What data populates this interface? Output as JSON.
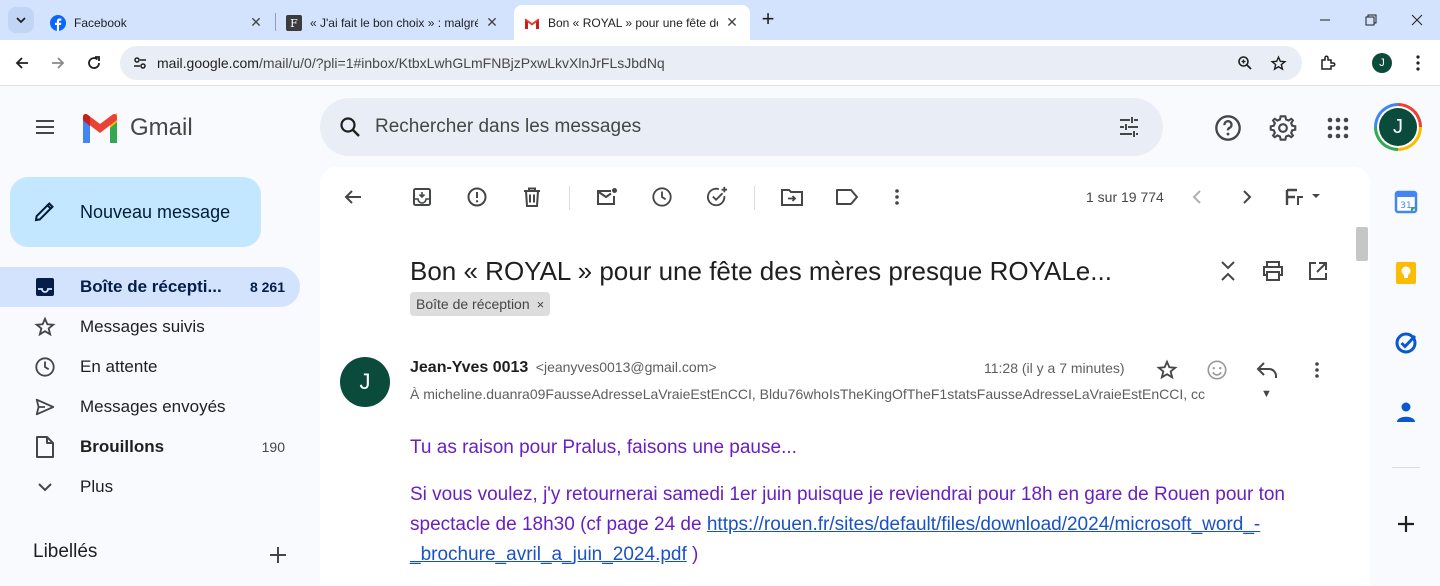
{
  "browser": {
    "tabs": [
      {
        "title": "Facebook",
        "icon": "facebook-icon",
        "active": false
      },
      {
        "title": "« J'ai fait le bon choix » : malgré",
        "icon": "newspaper-icon",
        "active": false
      },
      {
        "title": "Bon « ROYAL » pour une fête des",
        "icon": "gmail-icon",
        "active": true
      }
    ],
    "new_tab": "+",
    "url_host": "mail.google.com",
    "url_path": "/mail/u/0/?pli=1#inbox/KtbxLwhGLmFNBjzPxwLkvXlnJrFLsJbdNq",
    "profile_initial": "J"
  },
  "gmail": {
    "product_name": "Gmail",
    "search_placeholder": "Rechercher dans les messages",
    "account_initial": "J",
    "compose_label": "Nouveau message",
    "nav": [
      {
        "label": "Boîte de récepti...",
        "count": "8 261",
        "icon": "inbox-icon",
        "active": true
      },
      {
        "label": "Messages suivis",
        "count": "",
        "icon": "star-icon",
        "active": false
      },
      {
        "label": "En attente",
        "count": "",
        "icon": "clock-icon",
        "active": false
      },
      {
        "label": "Messages envoyés",
        "count": "",
        "icon": "send-icon",
        "active": false
      },
      {
        "label": "Brouillons",
        "count": "190",
        "icon": "draft-icon",
        "active": false
      },
      {
        "label": "Plus",
        "count": "",
        "icon": "chevron-down-icon",
        "active": false
      }
    ],
    "labels_header": "Libellés",
    "pager": "1 sur 19 774",
    "subject": "Bon « ROYAL » pour une fête des mères presque ROYALe...",
    "label_chip": "Boîte de réception",
    "label_chip_close": "×",
    "message": {
      "sender_initial": "J",
      "sender_name": "Jean-Yves 0013",
      "sender_email": "<jeanyves0013@gmail.com>",
      "time": "11:28 (il y a 7 minutes)",
      "recipients": "À micheline.duanra09FausseAdresseLaVraieEstEnCCI, Bldu76whoIsTheKingOfTheF1statsFausseAdresseLaVraieEstEnCCI, cc",
      "line1": "Tu as raison pour Pralus, faisons une pause...",
      "line2_text": "Si vous voulez, j'y retournerai samedi 1er juin puisque je reviendrai pour 18h en gare de Rouen pour ton spectacle de 18h30 (cf page 24 de ",
      "line2_link": "https://rouen.fr/sites/default/files/download/2024/microsoft_word_-_brochure_avril_a_juin_2024.pdf",
      "line2_end": " )"
    }
  },
  "colors": {
    "accent": "#0b57d0",
    "compose_bg": "#c2e7ff",
    "nav_active_bg": "#d3e3fd",
    "body_text": "#6a1fbf",
    "link": "#1a52c5",
    "avatar": "#0b4b3c"
  }
}
